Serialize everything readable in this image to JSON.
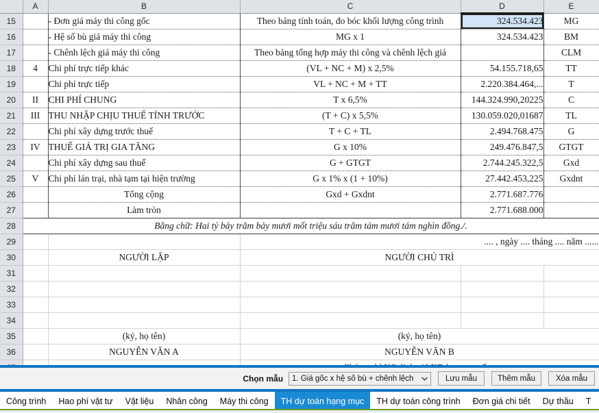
{
  "sheet": {
    "column_headers": [
      "A",
      "B",
      "C",
      "D",
      "E"
    ],
    "selected_cell": "D15",
    "rows": [
      {
        "n": "15",
        "a": "",
        "b": "- Đơn giá máy thi công gốc",
        "c": "Theo bảng tính toán, đo bóc khối lượng công trình",
        "d": "324.534.423",
        "e": "MG",
        "bold": false,
        "selected_d": true
      },
      {
        "n": "16",
        "a": "",
        "b": "- Hệ số bù giá máy thi công",
        "c": "MG x 1",
        "d": "324.534.423",
        "e": "BM",
        "bold": false,
        "selected_d": false
      },
      {
        "n": "17",
        "a": "",
        "b": "- Chênh lệch giá máy thi công",
        "c": "Theo bảng tổng hợp máy thi công và chênh lệch giá",
        "d": "",
        "e": "CLM",
        "bold": false,
        "selected_d": false
      },
      {
        "n": "18",
        "a": "4",
        "b": "Chi phí trực tiếp khác",
        "c": "(VL + NC + M) x 2,5%",
        "d": "54.155.718,65",
        "e": "TT",
        "bold": false,
        "selected_d": false
      },
      {
        "n": "19",
        "a": "",
        "b": "Chi phí trực tiếp",
        "c": "VL + NC + M + TT",
        "d": "2.220.384.464,...",
        "e": "T",
        "bold": true,
        "selected_d": false
      },
      {
        "n": "20",
        "a": "II",
        "b": "CHI PHÍ CHUNG",
        "c": "T x 6,5%",
        "d": "144.324.990,20225",
        "e": "C",
        "bold": false,
        "selected_d": false
      },
      {
        "n": "21",
        "a": "III",
        "b": "THU NHẬP CHỊU THUẾ TÍNH TRƯỚC",
        "c": "(T + C) x 5,5%",
        "d": "130.059.020,01687",
        "e": "TL",
        "bold": false,
        "selected_d": false
      },
      {
        "n": "22",
        "a": "",
        "b": "Chi phí xây dựng trước thuế",
        "c": "T + C + TL",
        "d": "2.494.768.475",
        "e": "G",
        "bold": true,
        "selected_d": false
      },
      {
        "n": "23",
        "a": "IV",
        "b": "THUẾ GIÁ TRỊ GIA TĂNG",
        "c": "G x 10%",
        "d": "249.476.847,5",
        "e": "GTGT",
        "bold": false,
        "selected_d": false
      },
      {
        "n": "24",
        "a": "",
        "b": "Chi phí xây dựng sau thuế",
        "c": "G + GTGT",
        "d": "2.744.245.322,5",
        "e": "Gxd",
        "bold": true,
        "selected_d": false
      },
      {
        "n": "25",
        "a": "V",
        "b": "Chi phí lán trại, nhà tạm tại hiện trường",
        "c": "G x 1% x (1 + 10%)",
        "d": "27.442.453,225",
        "e": "Gxdnt",
        "bold": false,
        "selected_d": false
      },
      {
        "n": "26",
        "a": "",
        "b": "Tổng cộng",
        "c": "Gxd + Gxdnt",
        "d": "2.771.687.776",
        "e": "",
        "bold": true,
        "selected_d": false,
        "b_center": true
      },
      {
        "n": "27",
        "a": "",
        "b": "Làm tròn",
        "c": "",
        "d": "2.771.688.000",
        "e": "",
        "bold": true,
        "selected_d": false,
        "b_center": true
      }
    ],
    "row28": {
      "n": "28",
      "text": "Bằng chữ: Hai tỷ bảy trăm bảy mươi mốt triệu sáu trăm tám mươi tám nghìn đồng./."
    },
    "row29": {
      "n": "29",
      "date_line": ".... , ngày .... tháng .... năm ......"
    },
    "row30": {
      "n": "30",
      "left": "NGƯỜI LẬP",
      "right": "NGƯỜI CHỦ TRÌ"
    },
    "blank_rows": [
      "31",
      "32",
      "33",
      "34"
    ],
    "row35": {
      "n": "35",
      "left": "(ký, họ tên)",
      "right": "(ký, họ tên)"
    },
    "row36": {
      "n": "36",
      "left": "NGUYỄN VĂN A",
      "right": "NGUYỄN VĂN B"
    },
    "row37": {
      "n": "37",
      "left": "",
      "right": "Chứng chỉ KS định giá XD hạng ..., số ..."
    }
  },
  "toolbar": {
    "label": "Chọn mẫu",
    "select_value": "1. Giá gốc x hệ số bù + chênh lệch",
    "chevron": "⌄",
    "buttons": [
      {
        "label": "Lưu mẫu"
      },
      {
        "label": "Thêm mẫu"
      },
      {
        "label": "Xóa mẫu"
      }
    ]
  },
  "tabs": [
    {
      "label": "Công trình",
      "active": false
    },
    {
      "label": "Hao phí vật tư",
      "active": false
    },
    {
      "label": "Vật liệu",
      "active": false
    },
    {
      "label": "Nhân công",
      "active": false
    },
    {
      "label": "Máy thi công",
      "active": false
    },
    {
      "label": "TH dự toán hạng mục",
      "active": true
    },
    {
      "label": "TH dự toán công trình",
      "active": false
    },
    {
      "label": "Đơn giá chi tiết",
      "active": false
    },
    {
      "label": "Dự thầu",
      "active": false
    },
    {
      "label": "T",
      "active": false
    }
  ],
  "colors": {
    "selection_fill": "#cfe4f7",
    "active_tab": "#1a8ad4",
    "blue_bar": "#1275c4",
    "green_line": "#6f9e1a",
    "header_gray": "#dfe3e8"
  }
}
